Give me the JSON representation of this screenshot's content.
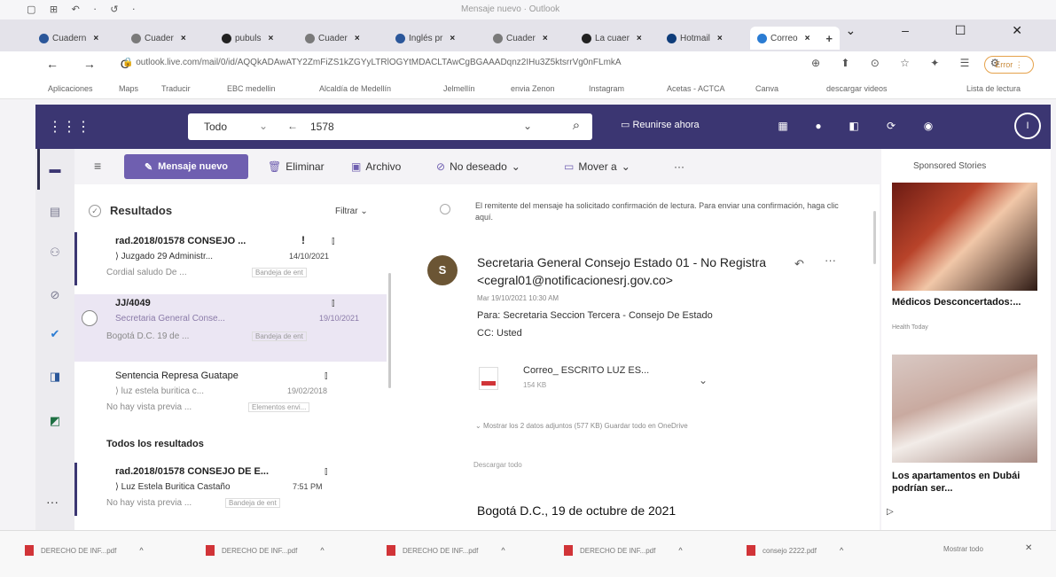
{
  "window": {
    "quick_access": "▢ ⊞ ↶ · ↺ ·",
    "title": "Mensaje nuevo · Outlook",
    "controls": "⌄ – ☐ ✕"
  },
  "tabs": [
    {
      "label": "Cuadern",
      "color": "#2b579a"
    },
    {
      "label": "Cuader",
      "color": "#7a7a7a"
    },
    {
      "label": "pubuls",
      "color": "#222222"
    },
    {
      "label": "Cuader",
      "color": "#7a7a7a"
    },
    {
      "label": "Inglés pr",
      "color": "#2b579a"
    },
    {
      "label": "Cuader",
      "color": "#7a7a7a"
    },
    {
      "label": "La cuaer",
      "color": "#222222"
    },
    {
      "label": "Hotmail",
      "color": "#0f3d7a"
    },
    {
      "label": "Correo",
      "color": "#2b7cd3"
    }
  ],
  "address": {
    "nav": "← → C",
    "url": "🔒 outlook.live.com/mail/0/id/AQQkADAwATY2ZmFiZS1kZGYyLTRlOGYtMDACLTAwCgBGAAADqnz2IHu3Z5ktsrrVg0nFLmkA",
    "icons": "⊕ ⬆ ⊙ ☆ ✦ ☰ ⚙",
    "profile": "Error ⋮"
  },
  "bookmarks": [
    "Aplicaciones",
    "Maps",
    "Traducir",
    "EBC medellin",
    "Alcaldía de Medellín",
    "Jelmellín",
    "envia Zenon",
    "Instagram",
    "Acetas - ACTCA",
    "Canva",
    "descargar videos",
    "Lista de lectura"
  ],
  "header": {
    "search_scope": "Todo",
    "search_query": "1578",
    "meet_label": "Reunirse ahora",
    "user_initial": "I"
  },
  "toolbar": {
    "new_message": "Mensaje nuevo",
    "delete": "Eliminar",
    "archive": "Archivo",
    "junk": "No deseado",
    "move": "Mover a",
    "more": "···"
  },
  "list": {
    "results_label": "Resultados",
    "filter_label": "Filtrar",
    "all_results_label": "Todos los resultados",
    "messages": [
      {
        "subject": "rad.2018/01578 CONSEJO ...",
        "sender": "⟩ Juzgado 29 Administr...",
        "date": "14/10/2021",
        "preview": "Cordial saludo De ...",
        "folder": "Bandeja de ent",
        "flag": "!"
      },
      {
        "subject": "JJ/4049",
        "sender": "Secretaria General Conse...",
        "date": "19/10/2021",
        "preview": "Bogotá D.C. 19 de ...",
        "folder": "Bandeja de ent"
      },
      {
        "subject": "Sentencia Represa Guatape",
        "sender": "⟩ luz estela buritica c...",
        "date": "19/02/2018",
        "preview": "No hay vista previa ...",
        "folder": "Elementos envi..."
      },
      {
        "subject": "rad.2018/01578 CONSEJO DE E...",
        "sender": "⟩ Luz Estela Buritica Castaño",
        "date": "7:51 PM",
        "preview": "No hay vista previa ...",
        "folder": "Bandeja de ent"
      }
    ]
  },
  "reading": {
    "receipt_notice": "El remitente del mensaje ha solicitado confirmación de lectura. Para enviar una confirmación, haga clic aquí.",
    "sender_initial": "S",
    "sender": "Secretaria General Consejo Estado 01 - No Registra <cegral01@notificacionesrj.gov.co>",
    "date": "Mar 19/10/2021 10:30 AM",
    "to": "Para: Secretaria Seccion Tercera - Consejo De Estado",
    "cc": "CC: Usted",
    "attachment_name": "Correo_ ESCRITO LUZ ES...",
    "attachment_size": "154 KB",
    "attachment_links": "Mostrar los 2 datos adjuntos (577 KB)   Guardar todo en OneDrive",
    "download_all": "Descargar todo",
    "body_date": "Bogotá D.C., 19 de octubre de 2021"
  },
  "ads": {
    "header": "Sponsored Stories",
    "items": [
      {
        "title": "Médicos Desconcertados:...",
        "source": "Health Today"
      },
      {
        "title": "Los apartamentos en Dubái podrían ser...",
        "source": ""
      }
    ]
  },
  "downloads": {
    "items": [
      "DERECHO DE INF...pdf",
      "DERECHO DE INF...pdf",
      "DERECHO DE INF...pdf",
      "DERECHO DE INF...pdf",
      "consejo 2222.pdf"
    ],
    "show_all": "Mostrar todo"
  }
}
